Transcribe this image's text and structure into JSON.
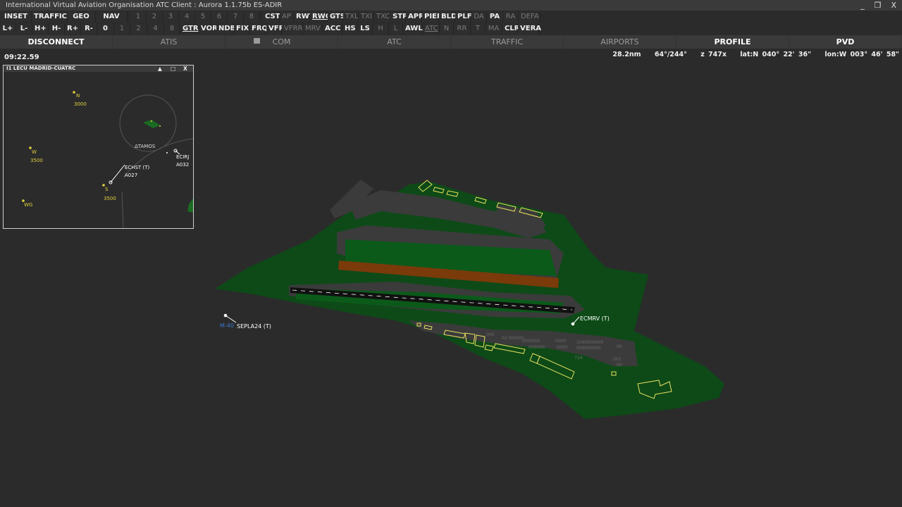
{
  "window": {
    "title": "International Virtual Aviation Organisation  ATC Client : Aurora 1.1.75b  ES-ADIR",
    "minimize": "_",
    "restore": "❐",
    "close": "X"
  },
  "toolbar_row1_left": [
    "INSET",
    "TRAFFIC",
    "GEO",
    "NAV"
  ],
  "toolbar_row1_numbers": [
    "1",
    "2",
    "3",
    "4",
    "5",
    "6",
    "7",
    "8"
  ],
  "toolbar_row1_filters": [
    {
      "label": "CST",
      "on": true
    },
    {
      "label": "AP",
      "on": false
    },
    {
      "label": "RWY",
      "on": true
    },
    {
      "label": "RWC",
      "on": true,
      "underline": true
    },
    {
      "label": "GTS",
      "on": true
    },
    {
      "label": "TXL",
      "on": false
    },
    {
      "label": "TXI",
      "on": false
    },
    {
      "label": "TXC",
      "on": false
    },
    {
      "label": "STP",
      "on": true
    },
    {
      "label": "APR",
      "on": true
    },
    {
      "label": "PIER",
      "on": true
    },
    {
      "label": "BLD",
      "on": true
    },
    {
      "label": "PLF",
      "on": true
    },
    {
      "label": "DA",
      "on": false
    },
    {
      "label": "PA",
      "on": true
    },
    {
      "label": "RA",
      "on": false
    },
    {
      "label": "DEFA",
      "on": false
    }
  ],
  "toolbar_row2_left": [
    {
      "label": "L+",
      "on": true
    },
    {
      "label": "L-",
      "on": true
    },
    {
      "label": "H+",
      "on": true
    },
    {
      "label": "H-",
      "on": true
    },
    {
      "label": "R+",
      "on": true
    },
    {
      "label": "R-",
      "on": true
    },
    {
      "label": "0",
      "on": true
    },
    {
      "label": "1",
      "on": false
    },
    {
      "label": "2",
      "on": false
    },
    {
      "label": "4",
      "on": false
    },
    {
      "label": "8",
      "on": false
    }
  ],
  "toolbar_row2_filters": [
    {
      "label": "GTR",
      "on": true,
      "underline": true
    },
    {
      "label": "VOR",
      "on": true
    },
    {
      "label": "NDB",
      "on": true
    },
    {
      "label": "FIX",
      "on": true
    },
    {
      "label": "FRQ",
      "on": true
    },
    {
      "label": "VFR",
      "on": true
    },
    {
      "label": "VFRR",
      "on": false
    },
    {
      "label": "MRV",
      "on": false
    },
    {
      "label": "ACC",
      "on": true
    },
    {
      "label": "HS",
      "on": true
    },
    {
      "label": "LS",
      "on": true
    },
    {
      "label": "H",
      "on": false
    },
    {
      "label": "L",
      "on": false
    },
    {
      "label": "AWL",
      "on": true
    },
    {
      "label": "ATC",
      "on": false,
      "underline": true
    },
    {
      "label": "N",
      "on": false
    },
    {
      "label": "RR",
      "on": false
    },
    {
      "label": "T",
      "on": false
    },
    {
      "label": "MA",
      "on": false
    },
    {
      "label": "CLR",
      "on": true
    },
    {
      "label": "VERA",
      "on": true
    }
  ],
  "navbar": [
    {
      "label": "DISCONNECT",
      "active": true
    },
    {
      "label": "ATIS",
      "active": false
    },
    {
      "label": "COM",
      "active": false,
      "chat_icon": true
    },
    {
      "label": "ATC",
      "active": false
    },
    {
      "label": "TRAFFIC",
      "active": false
    },
    {
      "label": "AIRPORTS",
      "active": false
    },
    {
      "label": "PROFILE",
      "active": true
    },
    {
      "label": "PVD",
      "active": true
    }
  ],
  "clock": "09:22.59",
  "readout": {
    "range": "28.2nm",
    "bearing": "64°/244°",
    "zoom": "z 747x",
    "lat": "lat:N 040° 22' 36\"",
    "lon": "lon:W 003° 46' 58\""
  },
  "inset": {
    "title": "I1  LECU MADRID-CUATRC",
    "btn_up": "▲",
    "btn_max": "□",
    "btn_close": "X",
    "fixes": [
      {
        "name": "N",
        "alt": "3000"
      },
      {
        "name": "W",
        "alt": "3500"
      },
      {
        "name": "S",
        "alt": "3500"
      },
      {
        "name": "WG",
        "alt": ""
      }
    ],
    "vor_label": "ΔTAMOS",
    "traffic": [
      {
        "callsign": "ECHST  (T)",
        "alt": "A027"
      },
      {
        "callsign": "ECIRJ",
        "alt": "A032"
      }
    ]
  },
  "main_map": {
    "traffic": [
      {
        "callsign": "ECMRV (T)"
      },
      {
        "callsign": "SEPLA24 (T)",
        "label": "M-40"
      }
    ],
    "colors": {
      "grass": "#0d4a17",
      "apron": "#3b3b3b",
      "runway": "#111111",
      "unpaved_runway": "#7a3a0a",
      "building": "#e8e060",
      "fix": "#e0d040",
      "road_label": "#3a78d0",
      "label": "#ffffff"
    }
  }
}
